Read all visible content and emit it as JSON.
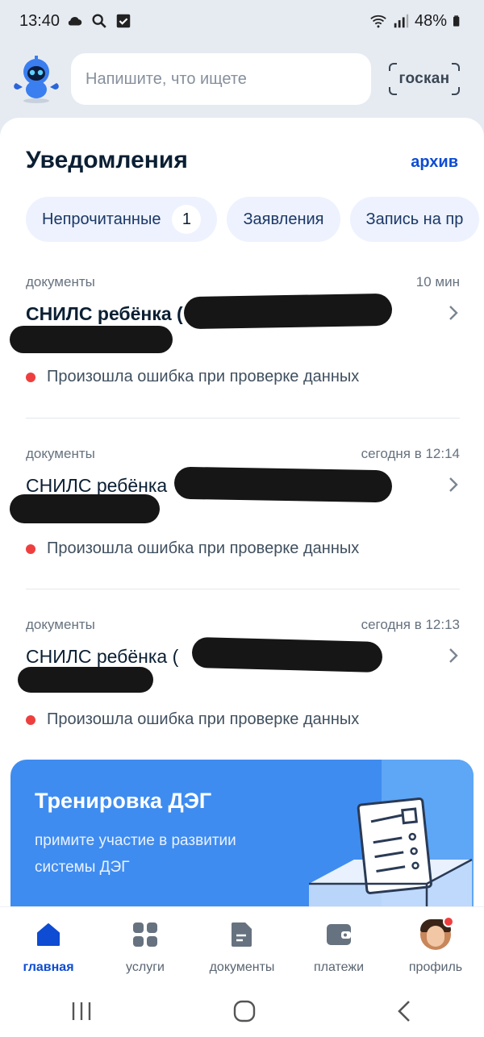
{
  "status_bar": {
    "time": "13:40",
    "battery": "48%",
    "icons": [
      "cloud-icon",
      "search-icon",
      "checkbox-icon",
      "wifi-icon",
      "signal-icon",
      "battery-icon"
    ]
  },
  "header": {
    "search_placeholder": "Напишите, что ищете",
    "scan_label": "госкан"
  },
  "notifications": {
    "title": "Уведомления",
    "archive_link": "архив",
    "chips": [
      {
        "label": "Непрочитанные",
        "count": "1"
      },
      {
        "label": "Заявления"
      },
      {
        "label": "Запись на пр"
      }
    ],
    "items": [
      {
        "category": "документы",
        "time": "10 мин",
        "title": "СНИЛС ребёнка (",
        "status": "Произошла ошибка при проверке данных"
      },
      {
        "category": "документы",
        "time": "сегодня в 12:14",
        "title": "СНИЛС ребёнка",
        "status": "Произошла ошибка при проверке данных"
      },
      {
        "category": "документы",
        "time": "сегодня в 12:13",
        "title": "СНИЛС ребёнка (",
        "status": "Произошла ошибка при проверке данных"
      }
    ]
  },
  "promo": {
    "title": "Тренировка ДЭГ",
    "text": "примите участие в развитии системы ДЭГ"
  },
  "bottom_nav": [
    {
      "label": "главная",
      "icon": "home-icon"
    },
    {
      "label": "услуги",
      "icon": "grid-icon"
    },
    {
      "label": "документы",
      "icon": "document-icon"
    },
    {
      "label": "платежи",
      "icon": "wallet-icon"
    },
    {
      "label": "профиль",
      "icon": "avatar"
    }
  ],
  "colors": {
    "accent": "#0d4cd3",
    "error": "#ee3f3f",
    "background": "#e6ebf2",
    "promo": "#3f8cf0"
  }
}
